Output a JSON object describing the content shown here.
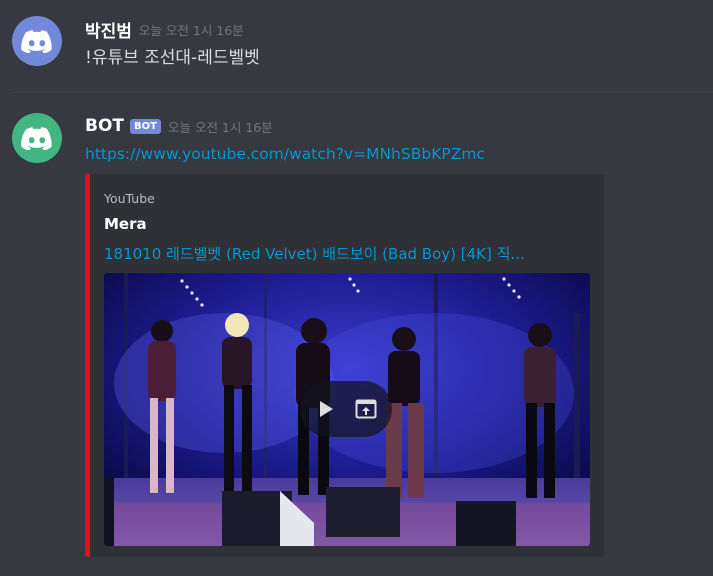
{
  "messages": [
    {
      "username": "박진범",
      "timestamp": "오늘 오전 1시 16분",
      "text": "!유튜브 조선대-레드벨벳",
      "avatar_color": "#7289da"
    },
    {
      "username": "BOT",
      "bot_tag": "BOT",
      "timestamp": "오늘 오전 1시 16분",
      "link": "https://www.youtube.com/watch?v=MNhSBbKPZmc",
      "avatar_color": "#43b581",
      "embed": {
        "provider": "YouTube",
        "author": "Mera",
        "title": "181010 레드벨벳 (Red Velvet) 배드보이 (Bad Boy) [4K] 직...",
        "accent_color": "#e3101c"
      }
    }
  ],
  "colors": {
    "background": "#36393f",
    "link": "#0096cf",
    "muted": "#72767d"
  },
  "icons": [
    "discord-logo-icon",
    "play-icon",
    "open-external-icon"
  ]
}
